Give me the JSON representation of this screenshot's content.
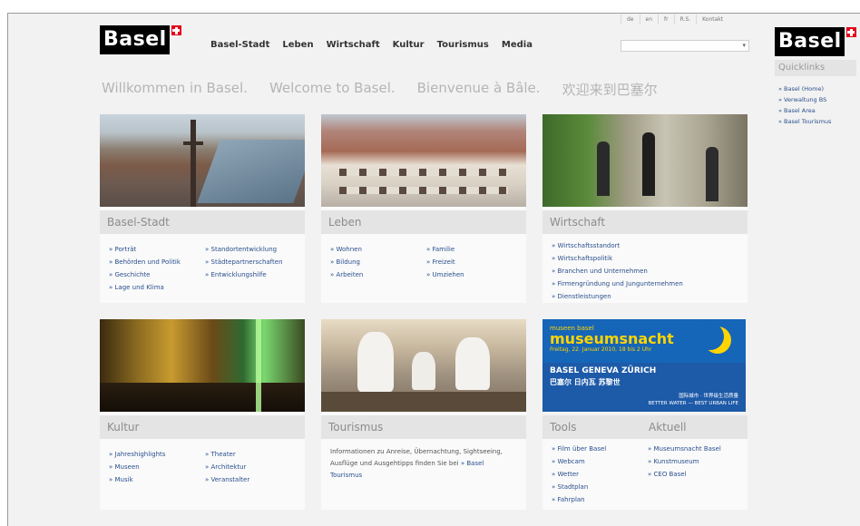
{
  "header": {
    "logo_text": "Basel",
    "nav": [
      "Basel-Stadt",
      "Leben",
      "Wirtschaft",
      "Kultur",
      "Tourismus",
      "Media"
    ],
    "lang": [
      "de",
      "en",
      "fr",
      "R.S.",
      "Kontakt"
    ],
    "search_icon": "▾"
  },
  "welcome": [
    "Willkommen in Basel.",
    "Welcome to Basel.",
    "Bienvenue à Bâle.",
    "欢迎来到巴塞尔"
  ],
  "sections": {
    "basel_stadt": {
      "title": "Basel-Stadt",
      "col1": [
        "» Porträt",
        "» Behörden und Politik",
        "» Geschichte",
        "» Lage und Klima"
      ],
      "col2": [
        "» Standortentwicklung",
        "» Städtepartnerschaften",
        "» Entwicklungshilfe"
      ]
    },
    "leben": {
      "title": "Leben",
      "col1": [
        "» Wohnen",
        "» Bildung",
        "» Arbeiten"
      ],
      "col2": [
        "» Familie",
        "» Freizeit",
        "» Umziehen"
      ]
    },
    "wirtschaft": {
      "title": "Wirtschaft",
      "items": [
        "» Wirtschaftsstandort",
        "» Wirtschaftspolitik",
        "» Branchen und Unternehmen",
        "» Firmengründung und Jungunternehmen",
        "» Dienstleistungen"
      ]
    },
    "kultur": {
      "title": "Kultur",
      "col1": [
        "» Jahreshighlights",
        "» Museen",
        "» Musik"
      ],
      "col2": [
        "» Theater",
        "» Architektur",
        "» Veranstalter"
      ]
    },
    "tourismus": {
      "title": "Tourismus",
      "text": "Informationen zu Anreise, Übernachtung, Sightseeing, Ausflüge und Ausgehtipps finden Sie bei",
      "link": "» Basel Tourismus"
    },
    "tools": {
      "title": "Tools",
      "items": [
        "» Film über Basel",
        "» Webcam",
        "» Wetter",
        "» Stadtplan",
        "» Fahrplan"
      ]
    },
    "aktuell": {
      "title": "Aktuell",
      "items": [
        "» Museumsnacht Basel",
        "» Kunstmuseum",
        "» CEO Basel"
      ]
    }
  },
  "ad": {
    "small": "museen basel",
    "big": "museumsnacht",
    "date": "Freitag, 22. Januar 2010, 18 bis 2 Uhr",
    "cities": "BASEL GENEVA ZÜRICH",
    "cn": "巴塞尔 日内瓦 苏黎世",
    "tag1": "国际城市 · 世界级生活质量",
    "tag2": "BETTER WATER — BEST URBAN LIFE"
  },
  "quicklinks": {
    "logo_text": "Basel",
    "title": "Quicklinks",
    "items": [
      "» Basel (Home)",
      "» Verwaltung BS",
      "» Basel Area",
      "» Basel Tourismus"
    ]
  }
}
